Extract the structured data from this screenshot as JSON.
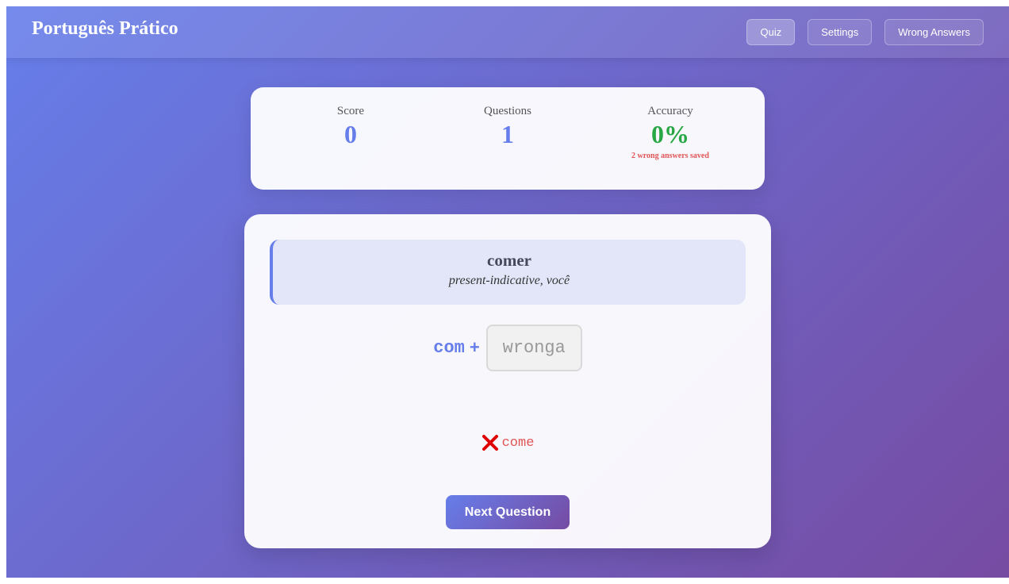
{
  "header": {
    "title": "Português Prático",
    "nav": [
      {
        "label": "Quiz",
        "active": true
      },
      {
        "label": "Settings",
        "active": false
      },
      {
        "label": "Wrong Answers",
        "active": false
      }
    ]
  },
  "stats": {
    "score_label": "Score",
    "score_value": "0",
    "questions_label": "Questions",
    "questions_value": "1",
    "accuracy_label": "Accuracy",
    "accuracy_value": "0%",
    "wrong_saved_note": "2 wrong answers saved"
  },
  "quiz": {
    "verb": "comer",
    "tense_person": "present-indicative, você",
    "stem": "com",
    "plus": "+",
    "user_input": "wronga",
    "feedback_icon": "cross-icon",
    "correct_answer": "come",
    "next_button": "Next Question"
  },
  "colors": {
    "accent": "#667eea",
    "accent_end": "#764ba2",
    "success": "#28a745",
    "error": "#e05555"
  }
}
